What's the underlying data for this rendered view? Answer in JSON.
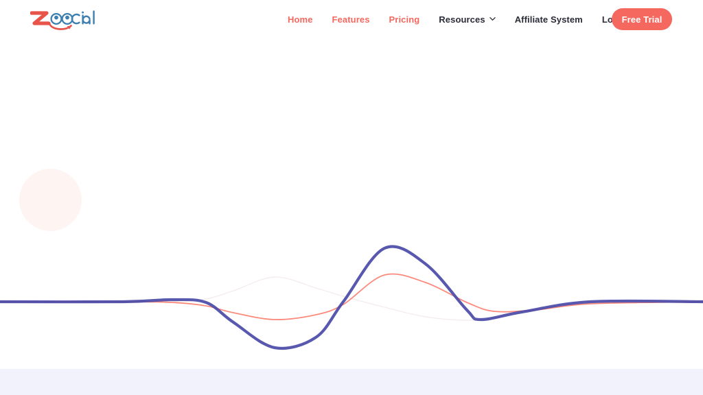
{
  "brand": {
    "name": "zoocial",
    "letters_lead": "z",
    "letters_tail": "cial",
    "icon": "zoocial-logo",
    "colors": {
      "coral": "#e8534a",
      "blue": "#3c7fb0"
    }
  },
  "nav": {
    "items": [
      {
        "label": "Home",
        "style": "accent",
        "icon": null
      },
      {
        "label": "Features",
        "style": "accent",
        "icon": null
      },
      {
        "label": "Pricing",
        "style": "accent",
        "icon": null
      },
      {
        "label": "Resources",
        "style": "dark",
        "icon": "chevron-down-icon"
      },
      {
        "label": "Affiliate System",
        "style": "dark",
        "icon": null
      },
      {
        "label": "Login",
        "style": "dark",
        "icon": null
      }
    ],
    "cta": {
      "label": "Free Trial",
      "bg": "#f4685f",
      "fg": "#ffffff"
    }
  },
  "hero": {
    "decor_circle": {
      "name": "pink-blob",
      "color": "#fef5f3"
    },
    "waves": [
      {
        "name": "wave-faint",
        "color": "#f3e9e9",
        "width": 1.4,
        "opacity": 0.85,
        "phase": "inverted"
      },
      {
        "name": "wave-coral",
        "color": "#fb8a7c",
        "width": 1.8,
        "opacity": 1,
        "phase": "normal"
      },
      {
        "name": "wave-blue",
        "color": "#4a4aa8",
        "width": 4.2,
        "opacity": 0.92,
        "phase": "normal"
      }
    ],
    "baseline_y": 440
  },
  "footer_band": {
    "name": "next-section-band",
    "color": "#f1f2fc"
  },
  "chart_data": {
    "type": "line",
    "title": "",
    "xlabel": "",
    "ylabel": "",
    "grid": false,
    "legend": "none",
    "xlim": [
      0,
      1024
    ],
    "ylim": [
      360,
      512
    ],
    "baseline": 440,
    "series": [
      {
        "name": "wave-faint",
        "color": "#f3e9e9",
        "x": [
          0,
          180,
          250,
          300,
          340,
          400,
          460,
          500,
          560,
          620,
          680,
          720,
          780,
          860,
          1024
        ],
        "y": [
          440,
          440,
          440,
          436,
          424,
          404,
          420,
          432,
          448,
          462,
          467,
          464,
          452,
          442,
          440
        ]
      },
      {
        "name": "wave-coral",
        "color": "#fb8a7c",
        "x": [
          0,
          180,
          250,
          300,
          340,
          400,
          460,
          500,
          560,
          620,
          680,
          720,
          780,
          860,
          1024
        ],
        "y": [
          440,
          440,
          441,
          446,
          456,
          466,
          459,
          444,
          401,
          412,
          441,
          454,
          452,
          443,
          440
        ]
      },
      {
        "name": "wave-blue",
        "color": "#4a4aa8",
        "x": [
          0,
          180,
          250,
          300,
          340,
          400,
          460,
          500,
          560,
          620,
          680,
          700,
          760,
          860,
          1024
        ],
        "y": [
          440,
          440,
          437,
          441,
          470,
          507,
          492,
          440,
          362,
          385,
          452,
          466,
          455,
          440,
          440
        ]
      }
    ]
  }
}
